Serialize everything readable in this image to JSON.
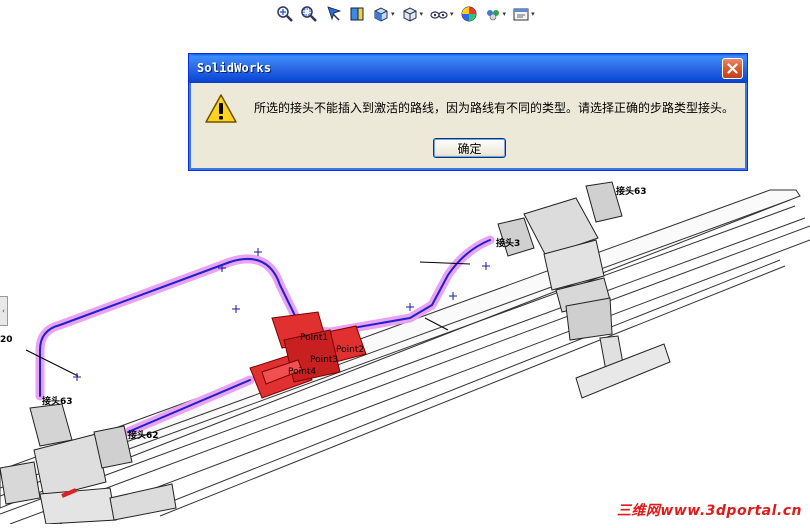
{
  "toolbar": {
    "items": [
      {
        "icon": "zoom-to-fit-icon"
      },
      {
        "icon": "zoom-to-area-icon"
      },
      {
        "icon": "previous-view-icon"
      },
      {
        "icon": "section-view-icon"
      },
      {
        "icon": "view-orientation-icon",
        "has_dropdown": true
      },
      {
        "icon": "display-style-icon",
        "has_dropdown": true
      },
      {
        "icon": "hide-show-items-icon",
        "has_dropdown": true
      },
      {
        "icon": "edit-appearance-icon"
      },
      {
        "icon": "apply-scene-icon",
        "has_dropdown": true
      },
      {
        "icon": "view-settings-icon",
        "has_dropdown": true
      }
    ],
    "dropdown_glyph": "▾"
  },
  "flyout_tab": {
    "glyph": "‹"
  },
  "dialog": {
    "title": "SolidWorks",
    "message": "所选的接头不能插入到激活的路线，因为路线有不同的类型。请选择正确的步路类型接头。",
    "ok_label": "确定",
    "close_glyph": "✕",
    "icon": "warning-icon"
  },
  "model": {
    "labels": {
      "fitting_top_right": "接头63",
      "fitting_top_left": "接头3",
      "fitting_bottom_left_top": "接头63",
      "fitting_bottom_left_right": "接头62",
      "partial_left": "20",
      "point1": "Point1",
      "point2": "Point2",
      "point3": "Point3",
      "point4": "Point4"
    }
  },
  "watermark": "三维网www.3dportal.cn",
  "colors": {
    "route_highlight": "#e9a3f0",
    "route_line": "#2020d0",
    "tee_fitting": "#e03030",
    "dialog_title": "#0a4ad8"
  }
}
